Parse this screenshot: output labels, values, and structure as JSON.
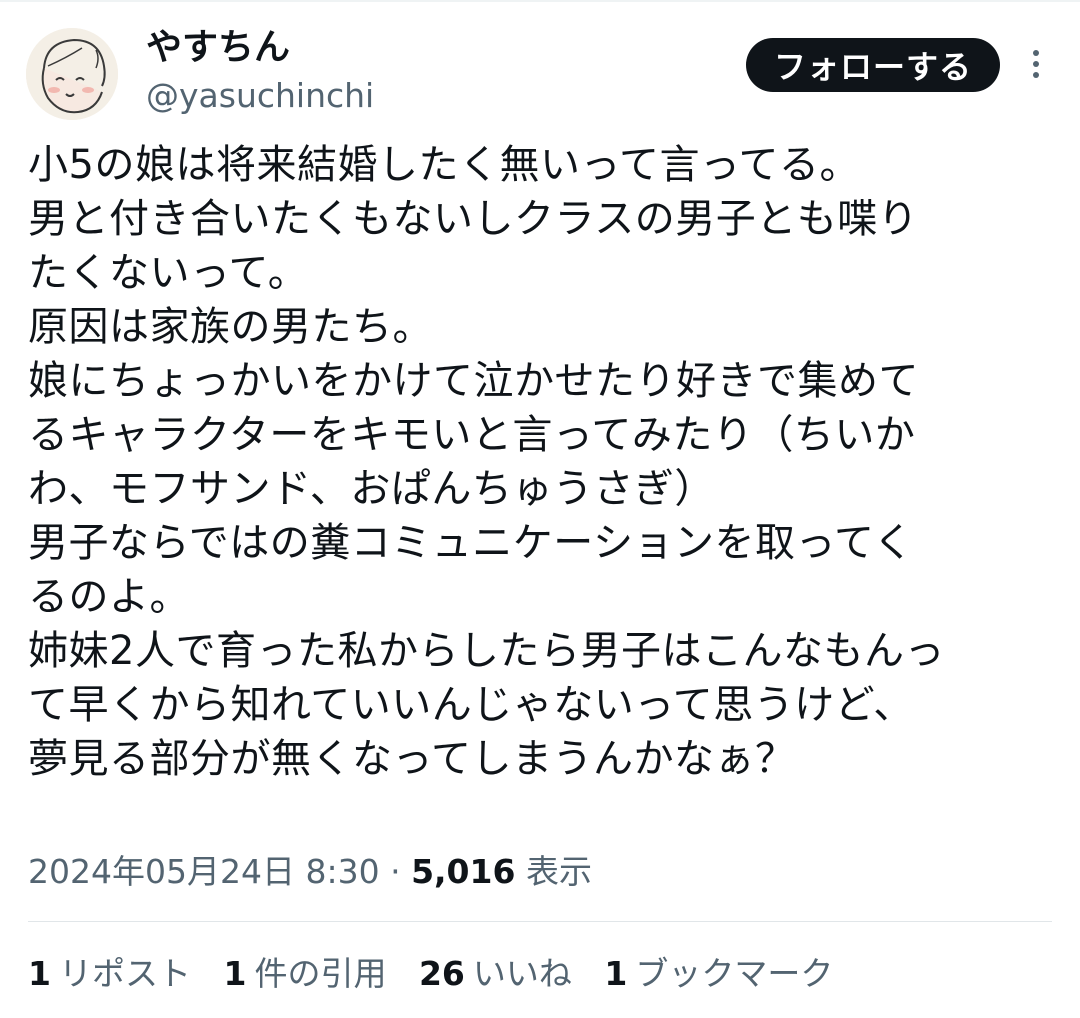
{
  "user": {
    "name": "やすちん",
    "handle": "@yasuchinchi"
  },
  "follow_label": "フォローする",
  "tweet_lines": [
    "小5の娘は将来結婚したく無いって言ってる。",
    "男と付き合いたくもないしクラスの男子とも喋り",
    "たくないって。",
    "原因は家族の男たち。",
    "娘にちょっかいをかけて泣かせたり好きで集めて",
    "るキャラクターをキモいと言ってみたり（ちいか",
    "わ、モフサンド、おぱんちゅうさぎ）",
    "男子ならではの糞コミュニケーションを取ってく",
    "るのよ。",
    "姉妹2人で育った私からしたら男子はこんなもんっ",
    "て早くから知れていいんじゃないって思うけど、",
    "夢見る部分が無くなってしまうんかなぁ？"
  ],
  "meta": {
    "datetime": "2024年05月24日 8:30",
    "separator": "·",
    "views_count": "5,016",
    "views_label": "表示"
  },
  "stats": [
    {
      "count": "1",
      "label": "リポスト"
    },
    {
      "count": "1",
      "label": "件の引用"
    },
    {
      "count": "26",
      "label": "いいね"
    },
    {
      "count": "1",
      "label": "ブックマーク"
    }
  ]
}
